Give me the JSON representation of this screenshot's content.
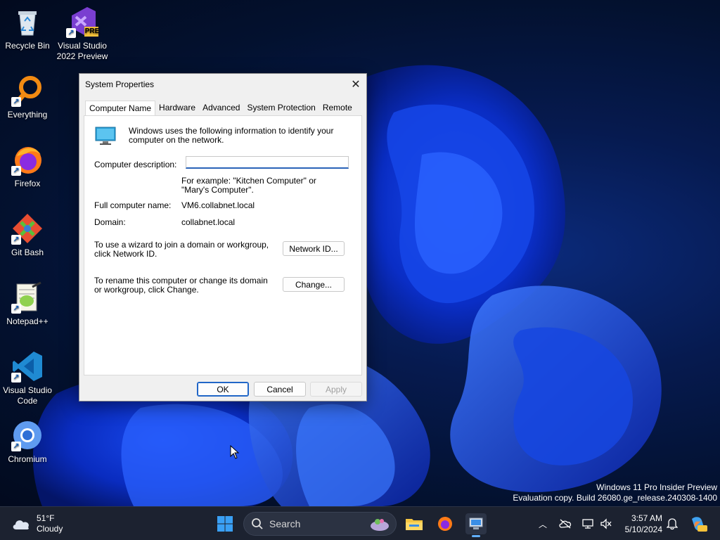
{
  "desktop": {
    "icons": [
      {
        "label": "Recycle Bin"
      },
      {
        "label": "Visual Studio 2022 Preview",
        "badge": "PRE"
      },
      {
        "label": "Everything"
      },
      {
        "label": "Firefox"
      },
      {
        "label": "Git Bash"
      },
      {
        "label": "Notepad++"
      },
      {
        "label": "Visual Studio Code"
      },
      {
        "label": "Chromium"
      }
    ],
    "watermark": {
      "line1": "Windows 11 Pro Insider Preview",
      "line2": "Evaluation copy. Build 26080.ge_release.240308-1400"
    }
  },
  "dialog": {
    "title": "System Properties",
    "close_glyph": "✕",
    "tabs": [
      "Computer Name",
      "Hardware",
      "Advanced",
      "System Protection",
      "Remote"
    ],
    "active_tab": "Computer Name",
    "intro_text": "Windows uses the following information to identify your computer on the network.",
    "description_label": "Computer description:",
    "description_value": "",
    "example_text": "For example: \"Kitchen Computer\" or \"Mary's Computer\".",
    "full_name_label": "Full computer name:",
    "full_name_value": "VM6.collabnet.local",
    "domain_label": "Domain:",
    "domain_value": "collabnet.local",
    "wizard_text": "To use a wizard to join a domain or workgroup, click Network ID.",
    "network_id_button": "Network ID...",
    "rename_text": "To rename this computer or change its domain or workgroup, click Change.",
    "change_button": "Change...",
    "ok_button": "OK",
    "cancel_button": "Cancel",
    "apply_button": "Apply"
  },
  "taskbar": {
    "weather": {
      "temp": "51°F",
      "condition": "Cloudy"
    },
    "search_placeholder": "Search",
    "apps": [
      "file-explorer-icon",
      "firefox-icon",
      "system-properties-icon"
    ],
    "clock": {
      "time": "3:57 AM",
      "date": "5/10/2024"
    }
  },
  "colors": {
    "accent": "#2166c7",
    "taskbar_bg": "#1c2230",
    "dialog_bg": "#f0f0f0"
  }
}
